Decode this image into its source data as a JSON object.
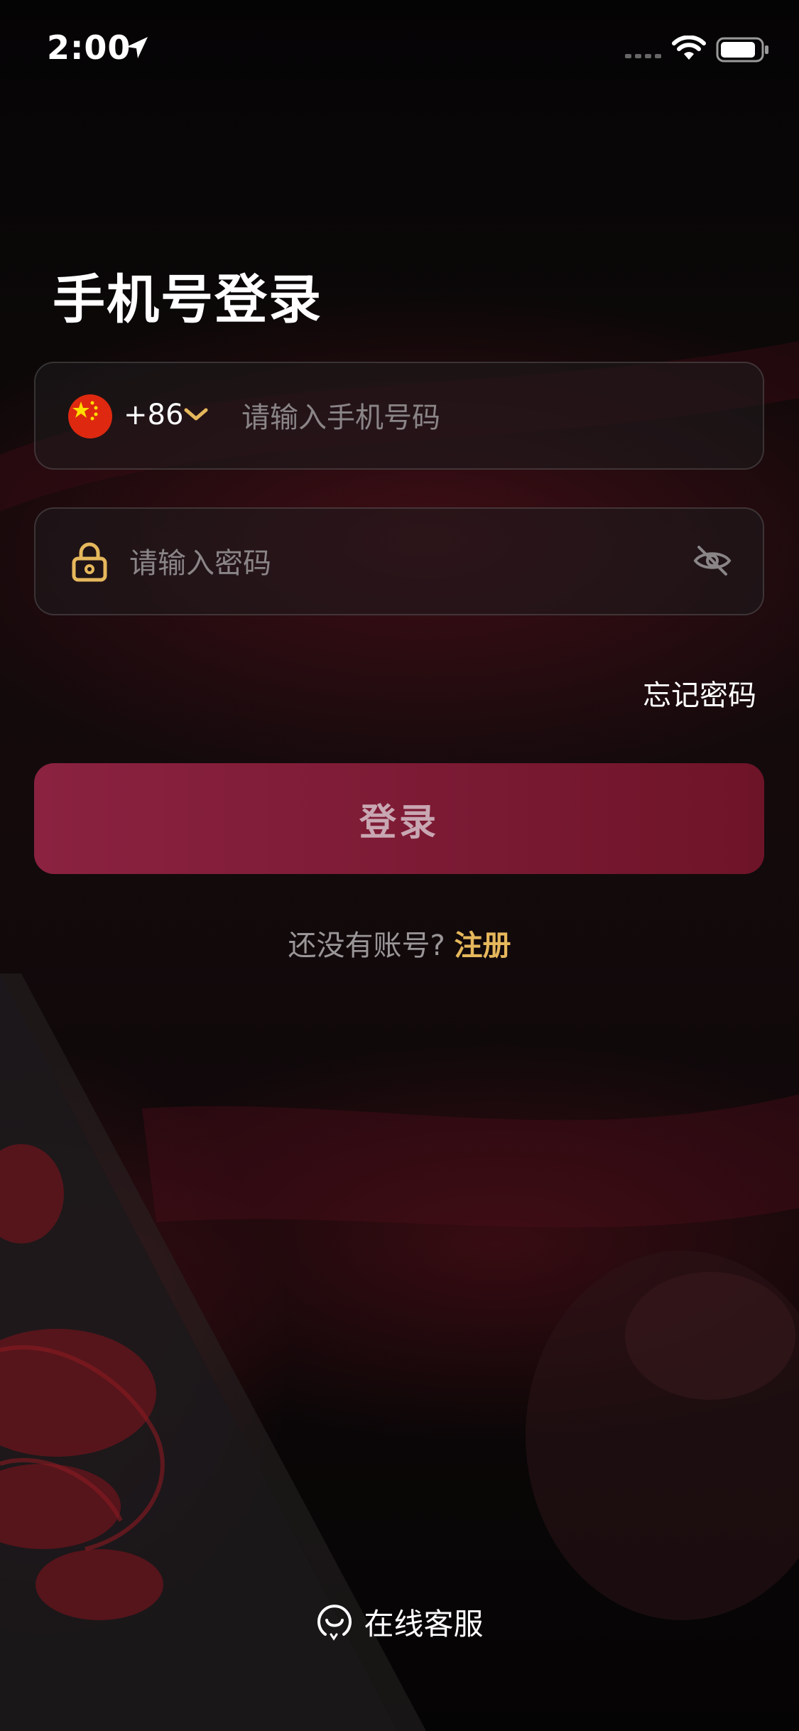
{
  "status_bar": {
    "time": "2:00",
    "icons": [
      "location-arrow-icon",
      "signal-dots-icon",
      "wifi-icon",
      "battery-icon"
    ]
  },
  "title": "手机号登录",
  "phone_field": {
    "flag": "china-flag-icon",
    "country_code": "+86",
    "placeholder": "请输入手机号码",
    "value": ""
  },
  "password_field": {
    "placeholder": "请输入密码",
    "value": ""
  },
  "forgot_password": "忘记密码",
  "login_button": "登录",
  "register": {
    "prompt": "还没有账号?",
    "link": "注册"
  },
  "support": "在线客服",
  "colors": {
    "accent_gold": "#e6b85c",
    "button_bg": "#7c1a34",
    "button_text": "#c8a7b2",
    "placeholder": "#8a8587"
  }
}
